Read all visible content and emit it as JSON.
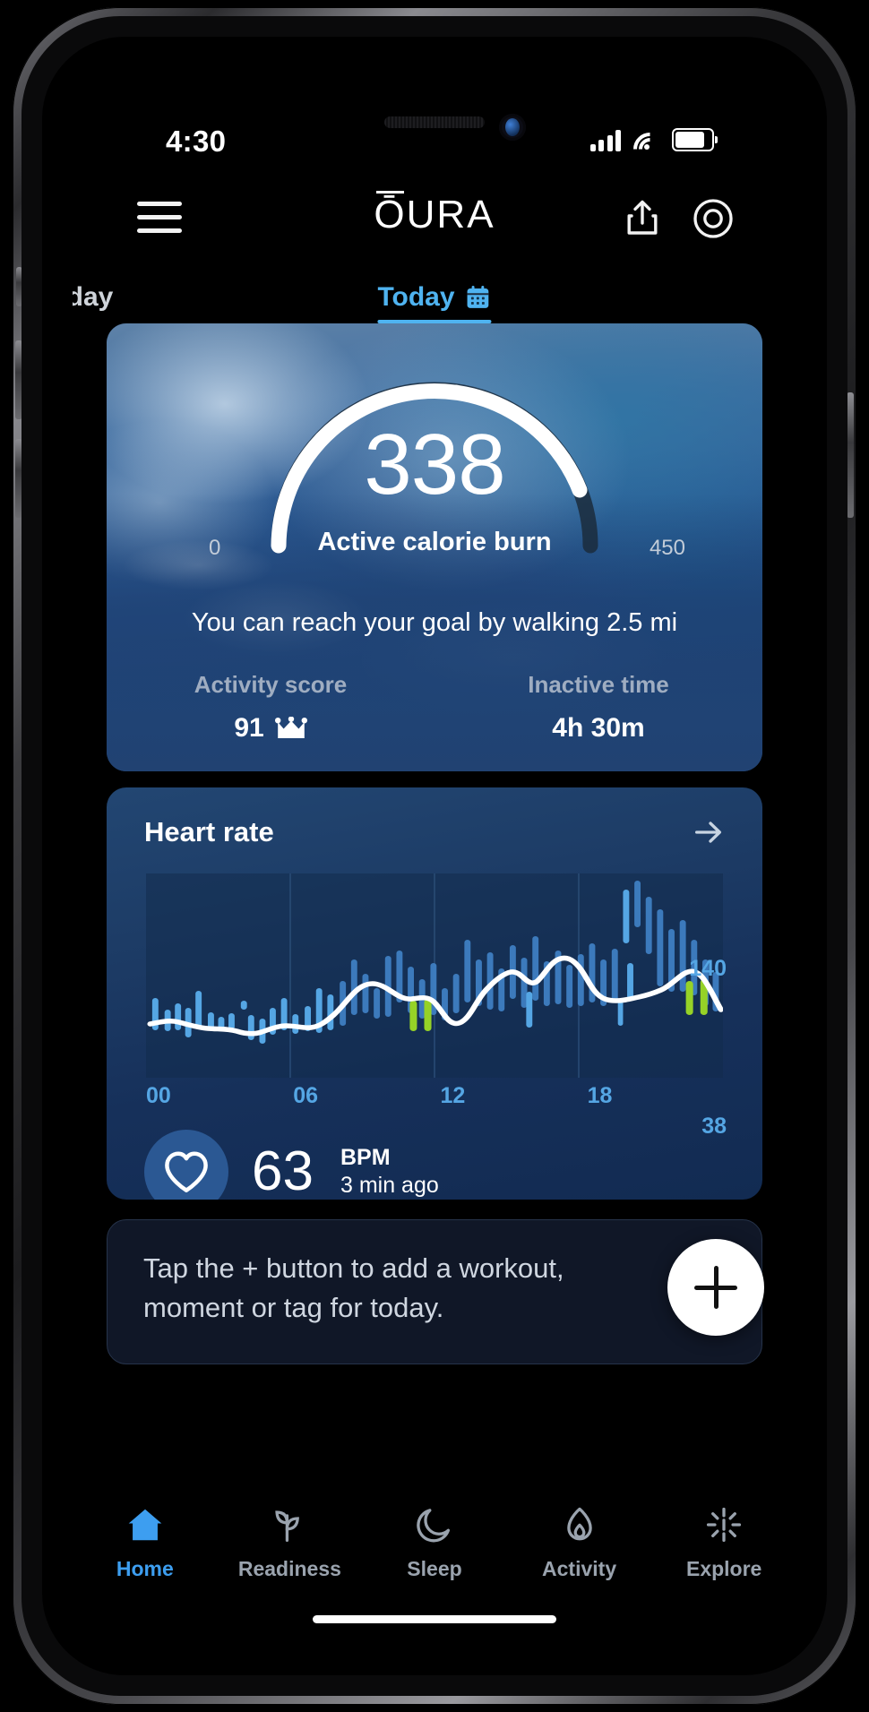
{
  "status_bar": {
    "time": "4:30",
    "signal_icon": "cellular-signal-icon",
    "wifi_icon": "wifi-icon",
    "battery_icon": "battery-icon"
  },
  "header": {
    "menu_icon": "hamburger-menu-icon",
    "brand": "ŌURA",
    "brand_o": "Ō",
    "brand_rest": "URA",
    "share_icon": "share-icon",
    "ring_icon": "oura-ring-icon"
  },
  "tabs": {
    "previous": "rday",
    "current": "Today",
    "calendar_icon": "calendar-icon"
  },
  "activity_card": {
    "value": "338",
    "label": "Active calorie burn",
    "gauge_min": "0",
    "gauge_max": "450",
    "goal_text": "You can reach your goal by walking 2.5 mi",
    "stats": [
      {
        "label": "Activity score",
        "value": "91",
        "icon": "crown-icon"
      },
      {
        "label": "Inactive time",
        "value": "4h 30m",
        "icon": ""
      }
    ]
  },
  "heart_rate_card": {
    "title": "Heart rate",
    "arrow_icon": "arrow-right-icon",
    "heart_icon": "heart-icon",
    "bpm_value": "63",
    "bpm_unit": "BPM",
    "bpm_time": "3 min ago",
    "y_max": "140",
    "y_min": "38",
    "x_labels": [
      "00",
      "06",
      "12",
      "18"
    ]
  },
  "tip_card": {
    "text": "Tap the + button to add a workout, moment or tag for today.",
    "fab_icon": "plus-icon"
  },
  "bottom_nav": {
    "items": [
      {
        "label": "Home",
        "icon": "home-icon",
        "active": true
      },
      {
        "label": "Readiness",
        "icon": "readiness-leaf-icon",
        "active": false
      },
      {
        "label": "Sleep",
        "icon": "moon-icon",
        "active": false
      },
      {
        "label": "Activity",
        "icon": "flame-icon",
        "active": false
      },
      {
        "label": "Explore",
        "icon": "explore-sun-icon",
        "active": false
      }
    ]
  },
  "colors": {
    "accent": "#4fb3f0",
    "card_blue": "#224672",
    "chart_blue": "#55a6e4",
    "chart_green": "#96d227"
  },
  "chart_data": {
    "type": "line",
    "title": "Heart rate",
    "xlabel": "",
    "ylabel": "BPM",
    "ylim": [
      38,
      140
    ],
    "x_tick_labels": [
      "00",
      "06",
      "12",
      "18"
    ],
    "x_tick_hours": [
      0,
      6,
      12,
      18
    ],
    "series": [
      {
        "name": "Heart rate trend",
        "type": "line",
        "color": "#ffffff",
        "x": [
          0,
          0.5,
          1,
          1.5,
          2,
          2.5,
          3,
          3.5,
          4,
          4.5,
          5,
          5.5,
          6,
          6.5,
          7,
          7.5,
          8,
          8.5,
          9,
          9.5,
          10,
          10.5,
          11,
          11.5,
          12,
          12.5,
          13,
          13.5,
          14,
          14.5,
          15,
          15.5,
          16,
          16.5,
          17,
          17.5,
          18,
          18.5,
          19,
          19.5,
          20
        ],
        "values": [
          56,
          55,
          55,
          54,
          54,
          53,
          52,
          52,
          53,
          54,
          55,
          58,
          64,
          70,
          72,
          70,
          69,
          70,
          71,
          69,
          60,
          58,
          63,
          72,
          78,
          80,
          79,
          82,
          86,
          87,
          84,
          78,
          74,
          73,
          72,
          73,
          78,
          84,
          83,
          72,
          66
        ]
      },
      {
        "name": "Heart rate samples",
        "type": "bar",
        "color": "#55a6e4",
        "x": [
          0.2,
          0.6,
          0.9,
          1.2,
          1.5,
          1.9,
          2.3,
          2.7,
          3.1,
          3.5,
          3.9,
          4.3,
          4.7,
          5.1,
          5.5,
          5.9,
          6.2,
          6.6,
          7.0,
          7.4,
          7.8,
          8.2,
          8.6,
          9.0,
          9.4,
          9.8,
          10.2,
          10.6,
          11.0,
          11.4,
          11.8,
          12.2,
          12.6,
          13.0,
          13.4,
          13.8,
          14.2,
          14.6,
          15.0,
          15.4,
          15.8,
          16.2,
          16.6,
          17.0,
          17.4,
          17.8,
          18.2,
          18.6,
          19.0,
          19.4
        ],
        "values": [
          62,
          58,
          61,
          68,
          57,
          50,
          54,
          47,
          52,
          60,
          56,
          51,
          58,
          66,
          70,
          95,
          88,
          82,
          96,
          90,
          85,
          80,
          92,
          75,
          70,
          68,
          72,
          88,
          94,
          86,
          98,
          92,
          84,
          80,
          90,
          96,
          86,
          78,
          74,
          60,
          88,
          100,
          112,
          124,
          118,
          96,
          82,
          76,
          70,
          66
        ]
      },
      {
        "name": "Workout highlight",
        "type": "bar",
        "color": "#96d227",
        "x": [
          9.35,
          9.7,
          18.4,
          18.8
        ],
        "values": [
          60,
          62,
          78,
          80
        ]
      }
    ]
  }
}
